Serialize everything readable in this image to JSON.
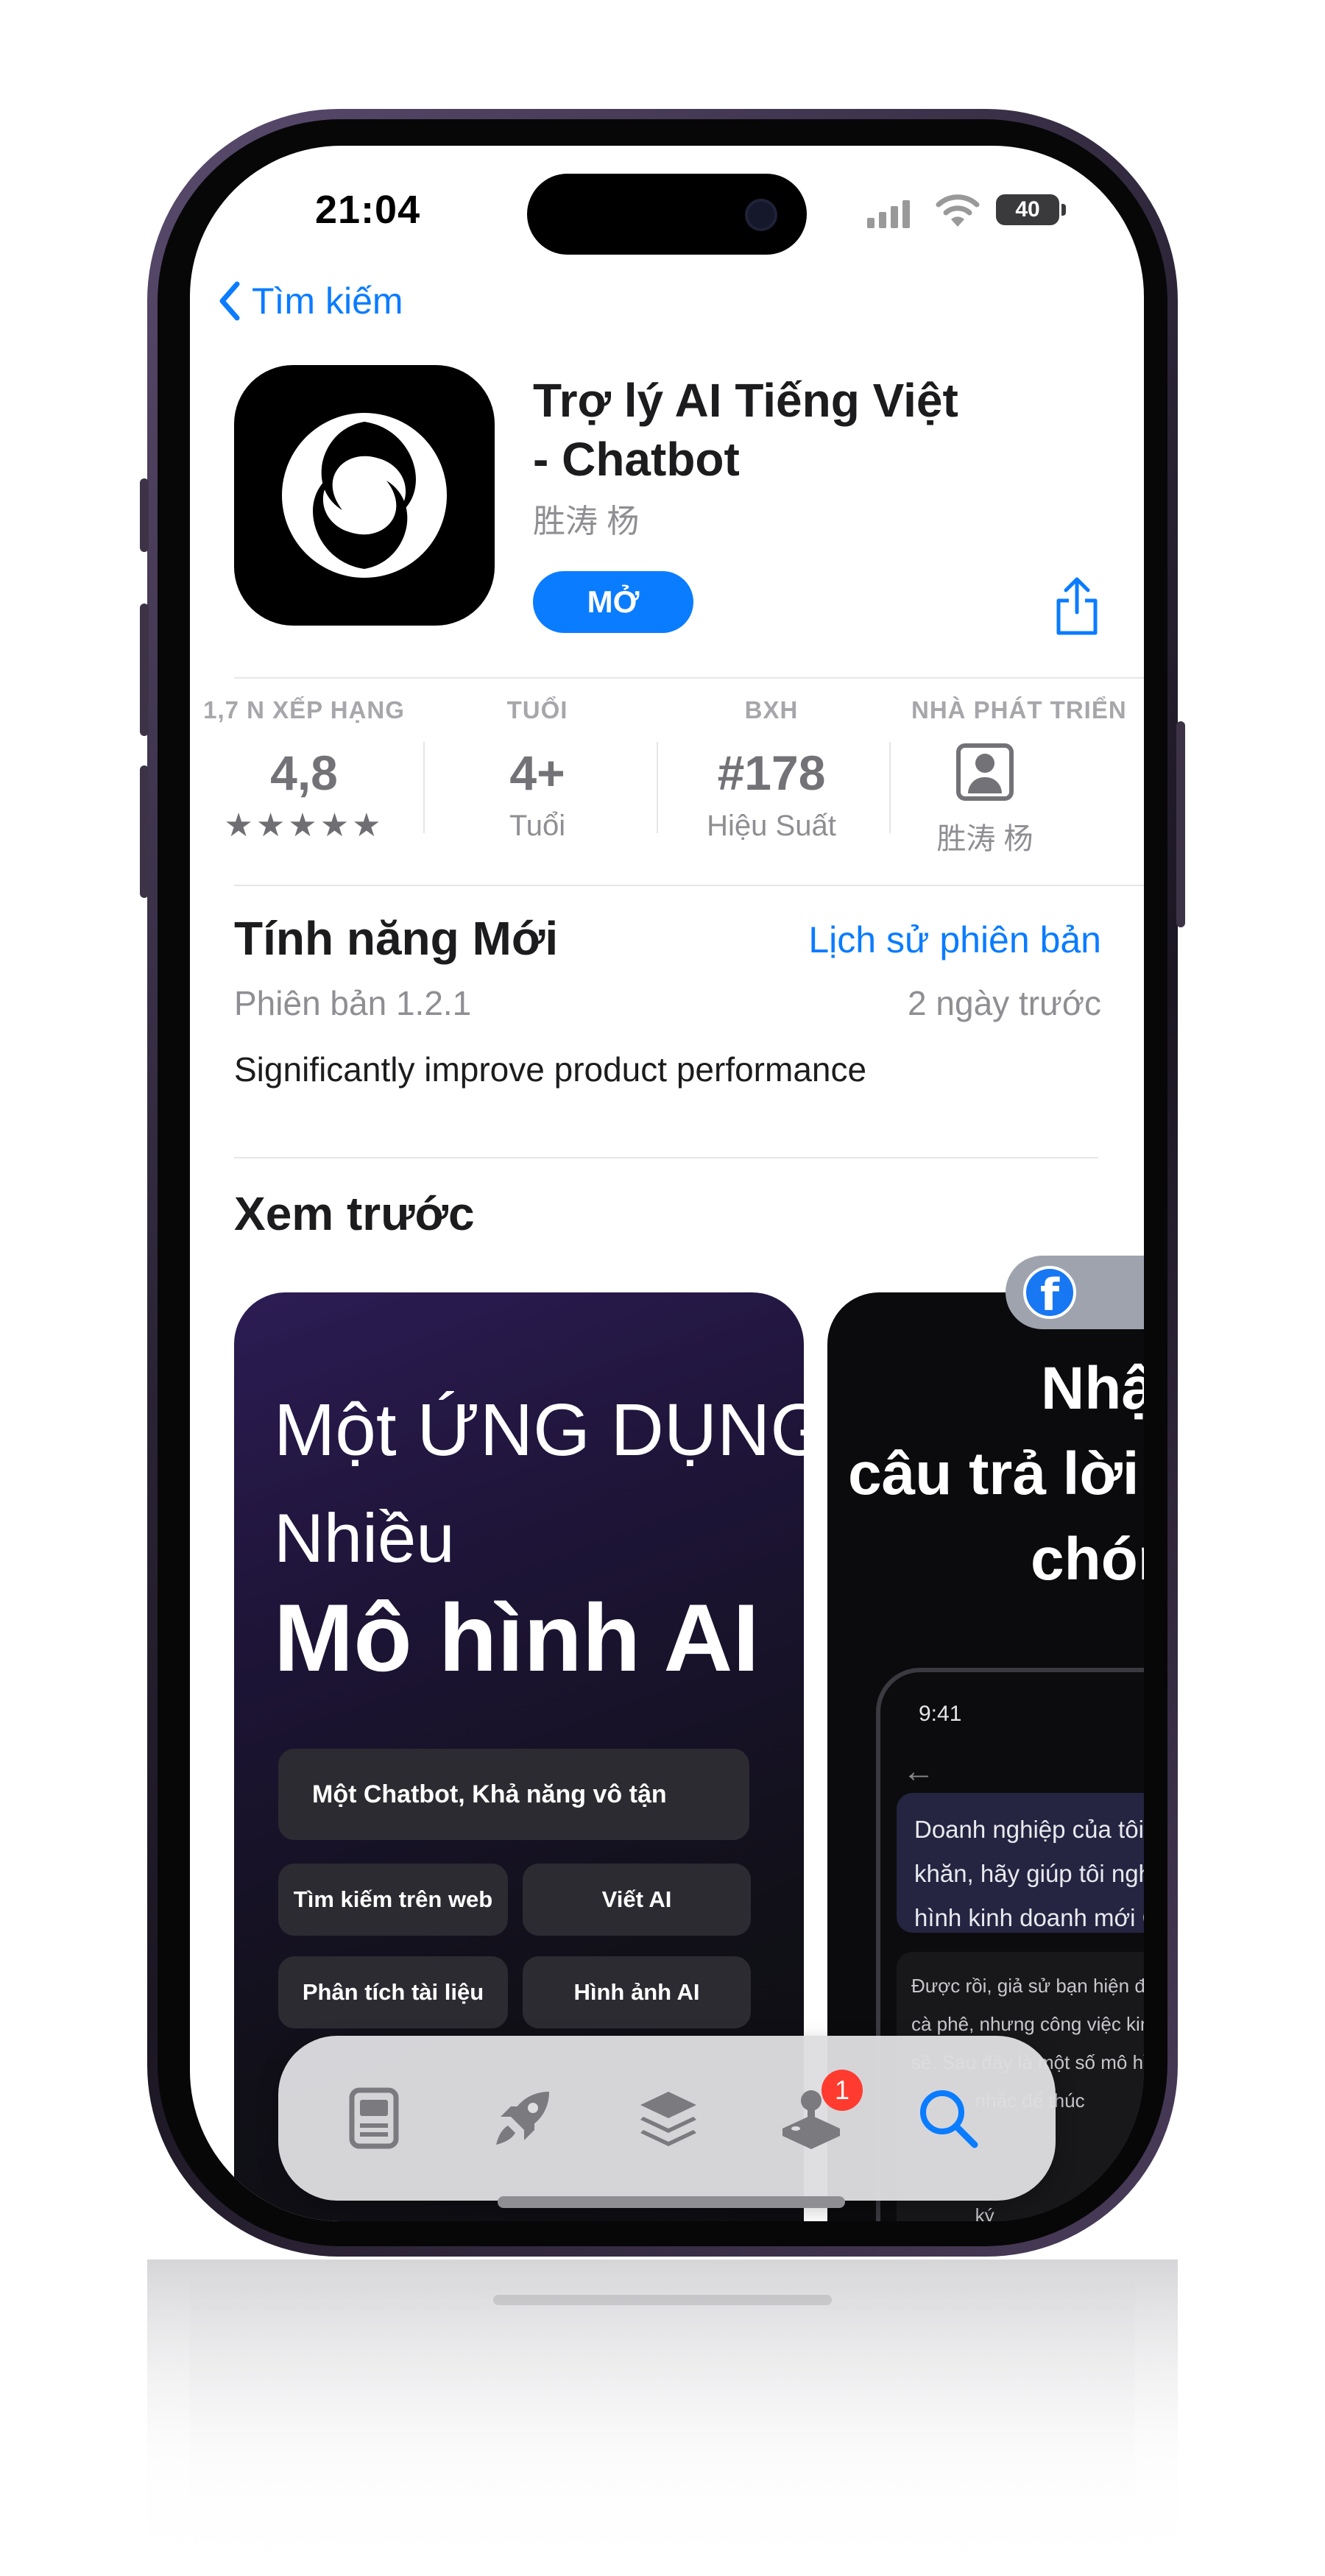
{
  "status_bar": {
    "time": "21:04",
    "battery": "40"
  },
  "nav": {
    "back_label": "Tìm kiếm"
  },
  "app": {
    "title_line1": "Trợ lý AI Tiếng Việt",
    "title_line2": "- Chatbot",
    "developer": "胜涛 杨",
    "open_label": "MỞ"
  },
  "info": [
    {
      "label": "1,7 N XẾP HẠNG",
      "value": "4,8",
      "sub": "★★★★★"
    },
    {
      "label": "TUỔI",
      "value": "4+",
      "sub": "Tuổi"
    },
    {
      "label": "BXH",
      "value": "#178",
      "sub": "Hiệu Suất"
    },
    {
      "label": "NHÀ PHÁT TRIỂN",
      "value": "",
      "sub": "胜涛 杨"
    }
  ],
  "whats_new": {
    "heading": "Tính năng Mới",
    "history_link": "Lịch sử phiên bản",
    "version": "Phiên bản 1.2.1",
    "date": "2 ngày trước",
    "notes": "Significantly improve product performance"
  },
  "preview": {
    "heading": "Xem trước",
    "shot1": {
      "line1": "Một ỨNG DỤNG,",
      "line2": "Nhiều",
      "line3": "Mô hình AI",
      "chip_main": "Một Chatbot, Khả năng vô tận",
      "chip_web": "Tìm kiếm trên web",
      "chip_write": "Viết AI",
      "chip_docs": "Phân tích tài liệu",
      "chip_image": "Hình ảnh AI"
    },
    "shot2": {
      "line1": "Nhậ",
      "line2": "câu trả lời",
      "line3": "chón",
      "mini_time": "9:41",
      "user_msg": "Doanh nghiệp của tôi đ\nkhăn, hãy giúp tôi nghĩ\nhình kinh doanh mới Ch",
      "ai_msg": "Được rồi, giả sử bạn hiện đang đ\ncà phê, nhưng công việc kinh doa\nsẽ. Sau đây là một số mô hình kin\n            nhắc để thúc\n\n\n            ký\nký cà phê, n\nhàng, đồ uống\nngọt hàng tháng và giao hà\nhoặc hàng tháng. Cũng"
    }
  },
  "tabbar": {
    "items": [
      {
        "name": "today",
        "icon": "today-icon"
      },
      {
        "name": "games",
        "icon": "rocket-icon"
      },
      {
        "name": "apps",
        "icon": "layers-icon"
      },
      {
        "name": "arcade",
        "icon": "joystick-icon",
        "badge": "1"
      },
      {
        "name": "search",
        "icon": "search-icon"
      }
    ]
  },
  "colors": {
    "accent": "#0a7cff",
    "badge": "#ff3b30"
  }
}
